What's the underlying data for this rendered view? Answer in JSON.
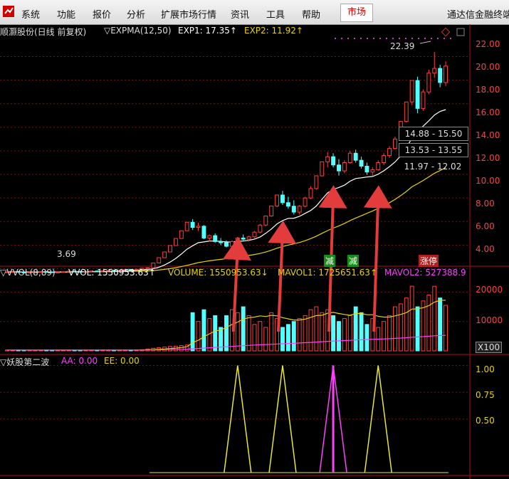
{
  "menu": {
    "items": [
      "系统",
      "功能",
      "报价",
      "分析",
      "扩展市场行情",
      "资讯",
      "工具",
      "帮助"
    ],
    "active": "市场",
    "brand": "通达信金融终端"
  },
  "price_panel": {
    "stock_title": "顺灏股份(日线 前复权)",
    "indicator": "▽EXPMA(12,50)",
    "exp1_label": "EXP1: 17.35↑",
    "exp2_label": "EXP2: 11.92↑",
    "high_label": "22.39",
    "low_label": "3.69",
    "ranges": [
      "14.88 - 15.50",
      "13.53 - 13.55",
      "11.97 - 12.02"
    ],
    "signal_labels": [
      "减",
      "减",
      "涨停"
    ],
    "y_ticks": [
      "22.00",
      "20.00",
      "18.00",
      "16.00",
      "14.00",
      "12.00",
      "10.00",
      "8.00",
      "6.00",
      "4.00"
    ]
  },
  "volume_panel": {
    "indicator": "▽VVOL(8,89)",
    "vvol": "VVOL: 1550953.63↑",
    "volume": "VOLUME: 1550953.63↓",
    "mavol1": "MAVOL1: 1725651.63↑",
    "mavol2": "MAVOL2: 527388.9",
    "y_ticks": [
      "20000",
      "10000"
    ],
    "unit": "X100"
  },
  "signal_panel": {
    "title": "▽妖股第二波",
    "aa": "AA: 0.00",
    "ee": "EE: 0.00",
    "y_ticks": [
      "1.00",
      "0.75",
      "0.50"
    ]
  },
  "colors": {
    "up": "#ff4040",
    "down": "#54ffff",
    "exp1": "#ffffff",
    "exp2": "#e6d400",
    "arrow": "#e23c3c",
    "signal_yellow": "#e8e63a",
    "signal_magenta": "#ff40ff",
    "grid": "#7a1010"
  },
  "chart_data": [
    {
      "type": "candlestick",
      "title": "顺灏股份(日线 前复权)",
      "ylim": [
        3,
        23
      ],
      "annotations": [
        "22.39",
        "3.69",
        "14.88 - 15.50",
        "13.53 - 13.55",
        "11.97 - 12.02"
      ],
      "candles": [
        [
          3.7,
          3.75,
          3.65,
          3.72
        ],
        [
          3.72,
          3.8,
          3.68,
          3.76
        ],
        [
          3.76,
          3.78,
          3.66,
          3.7
        ],
        [
          3.7,
          3.74,
          3.62,
          3.65
        ],
        [
          3.65,
          3.71,
          3.6,
          3.69
        ],
        [
          3.69,
          3.73,
          3.64,
          3.7
        ],
        [
          3.7,
          3.77,
          3.67,
          3.75
        ],
        [
          3.75,
          3.78,
          3.7,
          3.72
        ],
        [
          3.72,
          3.74,
          3.66,
          3.68
        ],
        [
          3.68,
          3.72,
          3.64,
          3.7
        ],
        [
          3.7,
          3.76,
          3.68,
          3.74
        ],
        [
          3.74,
          3.8,
          3.71,
          3.78
        ],
        [
          3.78,
          3.82,
          3.74,
          3.76
        ],
        [
          3.76,
          3.79,
          3.7,
          3.73
        ],
        [
          3.73,
          3.77,
          3.69,
          3.75
        ],
        [
          3.75,
          3.81,
          3.73,
          3.8
        ],
        [
          3.8,
          3.84,
          3.76,
          3.79
        ],
        [
          3.79,
          3.83,
          3.75,
          3.82
        ],
        [
          3.82,
          3.88,
          3.79,
          3.86
        ],
        [
          3.86,
          3.9,
          3.82,
          3.84
        ],
        [
          3.84,
          3.88,
          3.8,
          3.87
        ],
        [
          3.87,
          3.95,
          3.85,
          3.93
        ],
        [
          3.93,
          3.98,
          3.88,
          3.9
        ],
        [
          3.9,
          3.96,
          3.87,
          3.95
        ],
        [
          3.95,
          4.05,
          3.92,
          4.03
        ],
        [
          4.03,
          4.1,
          3.99,
          4.08
        ],
        [
          4.08,
          4.48,
          4.06,
          4.48
        ],
        [
          4.48,
          4.93,
          4.46,
          4.93
        ],
        [
          4.93,
          5.42,
          4.91,
          5.42
        ],
        [
          5.42,
          5.96,
          5.4,
          5.96
        ],
        [
          5.96,
          6.56,
          5.94,
          6.56
        ],
        [
          6.56,
          7.22,
          6.54,
          7.22
        ],
        [
          7.22,
          7.94,
          7.2,
          7.94
        ],
        [
          7.94,
          8.2,
          7.3,
          7.5
        ],
        [
          7.5,
          7.9,
          7.2,
          7.6
        ],
        [
          7.6,
          7.7,
          6.5,
          6.6
        ],
        [
          6.6,
          6.9,
          6.3,
          6.8
        ],
        [
          6.8,
          7.0,
          6.2,
          6.3
        ],
        [
          6.3,
          6.6,
          6.0,
          6.2
        ],
        [
          6.2,
          6.4,
          5.8,
          5.9
        ],
        [
          5.9,
          6.4,
          5.8,
          6.3
        ],
        [
          6.3,
          6.7,
          6.1,
          6.6
        ],
        [
          6.6,
          6.9,
          6.4,
          6.5
        ],
        [
          6.5,
          6.8,
          6.3,
          6.7
        ],
        [
          6.7,
          7.2,
          6.6,
          7.1
        ],
        [
          7.1,
          7.8,
          7.0,
          7.7
        ],
        [
          7.7,
          8.47,
          7.6,
          8.47
        ],
        [
          8.47,
          9.32,
          8.4,
          9.32
        ],
        [
          9.32,
          10.25,
          9.2,
          10.25
        ],
        [
          10.25,
          10.6,
          9.4,
          9.6
        ],
        [
          9.6,
          10.1,
          9.1,
          9.3
        ],
        [
          9.3,
          9.8,
          8.6,
          8.8
        ],
        [
          8.8,
          9.4,
          8.6,
          9.3
        ],
        [
          9.3,
          10.1,
          9.2,
          10.0
        ],
        [
          10.0,
          11.0,
          9.9,
          10.8
        ],
        [
          10.8,
          11.88,
          10.7,
          11.88
        ],
        [
          11.88,
          13.07,
          11.8,
          13.07
        ],
        [
          13.07,
          13.9,
          12.6,
          13.5
        ],
        [
          13.5,
          13.8,
          12.6,
          12.8
        ],
        [
          12.8,
          13.3,
          11.9,
          12.3
        ],
        [
          12.3,
          13.2,
          12.1,
          13.0
        ],
        [
          13.0,
          14.0,
          12.9,
          13.8
        ],
        [
          13.8,
          14.1,
          13.0,
          13.2
        ],
        [
          13.2,
          13.5,
          12.5,
          12.7
        ],
        [
          12.7,
          13.0,
          11.97,
          12.2
        ],
        [
          12.2,
          12.6,
          11.9,
          12.4
        ],
        [
          12.4,
          13.2,
          12.3,
          13.0
        ],
        [
          13.0,
          13.8,
          12.8,
          13.6
        ],
        [
          13.6,
          14.4,
          13.4,
          14.2
        ],
        [
          14.2,
          15.2,
          14.1,
          15.0
        ],
        [
          15.0,
          16.5,
          14.9,
          16.5
        ],
        [
          16.5,
          18.15,
          16.4,
          18.15
        ],
        [
          18.15,
          19.97,
          17.9,
          19.97
        ],
        [
          19.97,
          20.3,
          17.2,
          17.6
        ],
        [
          17.6,
          19.2,
          17.4,
          19.0
        ],
        [
          19.0,
          20.9,
          18.8,
          20.6
        ],
        [
          20.6,
          22.39,
          20.2,
          21.0
        ],
        [
          21.0,
          21.3,
          19.4,
          19.8
        ],
        [
          19.8,
          21.6,
          19.5,
          21.2
        ]
      ],
      "series": [
        {
          "name": "EXP1",
          "values": [
            3.72,
            3.73,
            3.72,
            3.71,
            3.71,
            3.7,
            3.71,
            3.71,
            3.71,
            3.71,
            3.71,
            3.72,
            3.73,
            3.73,
            3.73,
            3.74,
            3.75,
            3.76,
            3.77,
            3.79,
            3.8,
            3.82,
            3.83,
            3.85,
            3.88,
            3.91,
            3.99,
            4.12,
            4.31,
            4.56,
            4.87,
            5.24,
            5.65,
            5.94,
            6.2,
            6.27,
            6.35,
            6.34,
            6.32,
            6.26,
            6.27,
            6.32,
            6.35,
            6.4,
            6.51,
            6.69,
            7.0,
            7.36,
            7.8,
            8.08,
            8.27,
            8.28,
            8.44,
            8.69,
            8.94,
            9.32,
            9.89,
            10.43,
            10.73,
            10.89,
            11.09,
            11.43,
            11.65,
            11.71,
            11.78,
            11.83,
            12.02,
            12.31,
            12.66,
            13.06,
            13.58,
            14.28,
            15.07,
            15.65,
            16.1,
            16.55,
            17.04,
            17.35,
            17.5
          ]
        },
        {
          "name": "EXP2",
          "values": [
            3.72,
            3.72,
            3.72,
            3.72,
            3.72,
            3.72,
            3.72,
            3.72,
            3.72,
            3.72,
            3.72,
            3.72,
            3.73,
            3.73,
            3.73,
            3.73,
            3.74,
            3.74,
            3.75,
            3.75,
            3.76,
            3.77,
            3.78,
            3.79,
            3.8,
            3.81,
            3.84,
            3.88,
            3.94,
            4.0,
            4.08,
            4.17,
            4.28,
            4.39,
            4.51,
            4.59,
            4.67,
            4.73,
            4.79,
            4.85,
            4.91,
            4.98,
            5.05,
            5.12,
            5.2,
            5.29,
            5.41,
            5.56,
            5.74,
            5.88,
            6.0,
            6.1,
            6.22,
            6.37,
            6.55,
            6.76,
            7.0,
            7.23,
            7.44,
            7.63,
            7.84,
            8.08,
            8.3,
            8.49,
            8.7,
            8.9,
            9.12,
            9.35,
            9.6,
            9.88,
            10.2,
            10.55,
            10.95,
            11.21,
            11.49,
            11.79,
            12.1,
            12.33,
            12.57
          ]
        }
      ]
    },
    {
      "type": "bar",
      "title": "VVOL(8,89)",
      "ylim": [
        0,
        23000
      ],
      "unit": "X100",
      "values": [
        300,
        280,
        320,
        250,
        260,
        240,
        270,
        300,
        260,
        240,
        270,
        300,
        280,
        260,
        250,
        310,
        280,
        300,
        320,
        260,
        300,
        330,
        290,
        350,
        420,
        650,
        900,
        1100,
        1300,
        1500,
        1600,
        1800,
        2000,
        13000,
        10000,
        14000,
        11000,
        12000,
        8000,
        12000,
        14000,
        13000,
        15000,
        12000,
        9000,
        10000,
        8000,
        13000,
        11000,
        8000,
        9000,
        10000,
        11000,
        12000,
        14000,
        15000,
        13000,
        14000,
        12000,
        10000,
        11000,
        12000,
        15000,
        13000,
        9000,
        11000,
        8000,
        10000,
        12000,
        15000,
        16000,
        18000,
        22000,
        15000,
        17000,
        19000,
        22000,
        18000,
        15500
      ],
      "series": [
        {
          "name": "MAVOL1",
          "values": [
            300,
            295,
            300,
            290,
            285,
            280,
            280,
            285,
            280,
            275,
            275,
            280,
            280,
            278,
            275,
            280,
            280,
            285,
            290,
            285,
            288,
            292,
            292,
            300,
            320,
            370,
            440,
            540,
            660,
            800,
            950,
            1150,
            1400,
            2800,
            3600,
            4800,
            5800,
            6800,
            7100,
            8000,
            9000,
            9800,
            10800,
            11300,
            11500,
            11900,
            11700,
            12100,
            11900,
            11300,
            10900,
            10500,
            10500,
            10800,
            11400,
            12000,
            12100,
            12800,
            13100,
            12700,
            12400,
            12100,
            12700,
            12700,
            12300,
            12300,
            11800,
            11500,
            11500,
            11900,
            12400,
            13000,
            14200,
            14300,
            14700,
            15400,
            16600,
            17200,
            17250
          ]
        },
        {
          "name": "MAVOL2",
          "values": [
            300,
            300,
            300,
            300,
            300,
            300,
            300,
            300,
            300,
            300,
            300,
            300,
            300,
            300,
            300,
            300,
            300,
            300,
            300,
            300,
            300,
            300,
            300,
            300,
            310,
            320,
            340,
            370,
            400,
            430,
            470,
            520,
            570,
            700,
            820,
            950,
            1070,
            1190,
            1290,
            1400,
            1520,
            1640,
            1770,
            1880,
            1980,
            2080,
            2160,
            2260,
            2360,
            2430,
            2510,
            2590,
            2680,
            2780,
            2890,
            3010,
            3120,
            3240,
            3340,
            3420,
            3500,
            3590,
            3710,
            3800,
            3870,
            3950,
            4000,
            4060,
            4140,
            4250,
            4360,
            4480,
            4640,
            4740,
            4850,
            4980,
            5130,
            5220,
            5274
          ]
        }
      ]
    },
    {
      "type": "line",
      "title": "妖股第二波",
      "ylim": [
        0,
        1.05
      ],
      "series": [
        {
          "name": "AA",
          "values": [
            0,
            0,
            0,
            0,
            0,
            0,
            0,
            0,
            0,
            0,
            0,
            0,
            0,
            0,
            0,
            0,
            0,
            0,
            0,
            0,
            0,
            0,
            0,
            0,
            0,
            0,
            0,
            0,
            0,
            0,
            0,
            0,
            0,
            0,
            0,
            0,
            0,
            0,
            0,
            0,
            0,
            1,
            0,
            0,
            0,
            0,
            0,
            0,
            0,
            0,
            0,
            0,
            0,
            0,
            0,
            0,
            0,
            0,
            0,
            0,
            0,
            0,
            0,
            0,
            0,
            0,
            0,
            0,
            0,
            0,
            0,
            0,
            0,
            0,
            0,
            0,
            0,
            0,
            0
          ]
        },
        {
          "name": "EE",
          "values": [
            0,
            0,
            0,
            0,
            0,
            0,
            0,
            0,
            0,
            0,
            0,
            0,
            0,
            0,
            0,
            0,
            0,
            0,
            0,
            0,
            0,
            0,
            0,
            0,
            0,
            0,
            0,
            0,
            0,
            0,
            0,
            0,
            0,
            0,
            0,
            0,
            0,
            0,
            0,
            0,
            0,
            0,
            0,
            0,
            0,
            0,
            0,
            0,
            0,
            0,
            0,
            0,
            0,
            0,
            0,
            0,
            0,
            0,
            0,
            0,
            0,
            0,
            0,
            0,
            0,
            0,
            0,
            0,
            0,
            0,
            0,
            0,
            0,
            0,
            0,
            0,
            0,
            0,
            0
          ]
        }
      ],
      "events": [
        {
          "index": 41,
          "value": 1.0,
          "color": "yellow"
        },
        {
          "index": 49,
          "value": 1.0,
          "color": "yellow"
        },
        {
          "index": 58,
          "value": 1.0,
          "color": "magenta"
        },
        {
          "index": 66,
          "value": 1.0,
          "color": "yellow"
        }
      ]
    }
  ]
}
